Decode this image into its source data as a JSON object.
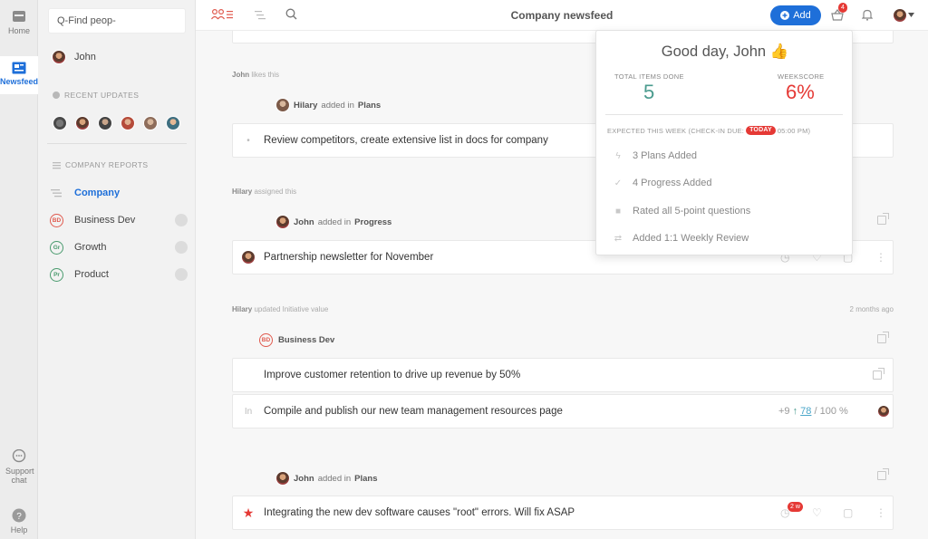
{
  "rail": {
    "home": "Home",
    "newsfeed": "Newsfeed",
    "support": "Support chat",
    "help": "Help"
  },
  "sidebar": {
    "search_value": "Q-Find peop-",
    "user": "John",
    "recent_updates": "RECENT UPDATES",
    "company_reports": "COMPANY REPORTS",
    "items": [
      {
        "label": "Company",
        "tag": ""
      },
      {
        "label": "Business Dev",
        "tag": "BD"
      },
      {
        "label": "Growth",
        "tag": "Gr"
      },
      {
        "label": "Product",
        "tag": "Pr"
      }
    ]
  },
  "topbar": {
    "title": "Company newsfeed",
    "add_label": "Add",
    "notif_count": "4"
  },
  "popover": {
    "greeting": "Good day, John",
    "total_label": "TOTAL ITEMS DONE",
    "total_value": "5",
    "weekscore_label": "WEEKSCORE",
    "weekscore_value": "6%",
    "expected_label": "EXPECTED THIS WEEK (CHECK-IN DUE:",
    "today": "TODAY",
    "time": "05:00 PM)",
    "items": [
      "3 Plans Added",
      "4 Progress Added",
      "Rated all 5-point questions",
      "Added 1:1 Weekly Review"
    ]
  },
  "feed": {
    "meta1": {
      "who": "John",
      "action": "likes this"
    },
    "actor1": {
      "name": "Hilary",
      "verb": "added in",
      "target": "Plans"
    },
    "card1": "Review competitors, create extensive list in docs for company",
    "meta2": {
      "who": "Hilary",
      "action": "assigned this"
    },
    "actor2": {
      "name": "John",
      "verb": "added in",
      "target": "Progress"
    },
    "card2": "Partnership newsletter for November",
    "meta3": {
      "who": "Hilary",
      "action": "updated Initiative value",
      "time": "2 months ago"
    },
    "actor3": {
      "tag": "BD",
      "name": "Business Dev"
    },
    "card3": "Improve customer retention to drive up revenue by 50%",
    "card4": {
      "lead": "In",
      "text": "Compile and publish our new team management resources page",
      "delta": "+9",
      "value": "78",
      "total": "/ 100 %"
    },
    "actor4": {
      "name": "John",
      "verb": "added in",
      "target": "Plans"
    },
    "card5": {
      "text": "Integrating the new dev software causes \"root\" errors. Will fix ASAP",
      "badge": "2 w"
    }
  },
  "colors": {
    "accent": "#1e6fd9",
    "danger": "#e53935",
    "green": "#4a9b8e"
  }
}
